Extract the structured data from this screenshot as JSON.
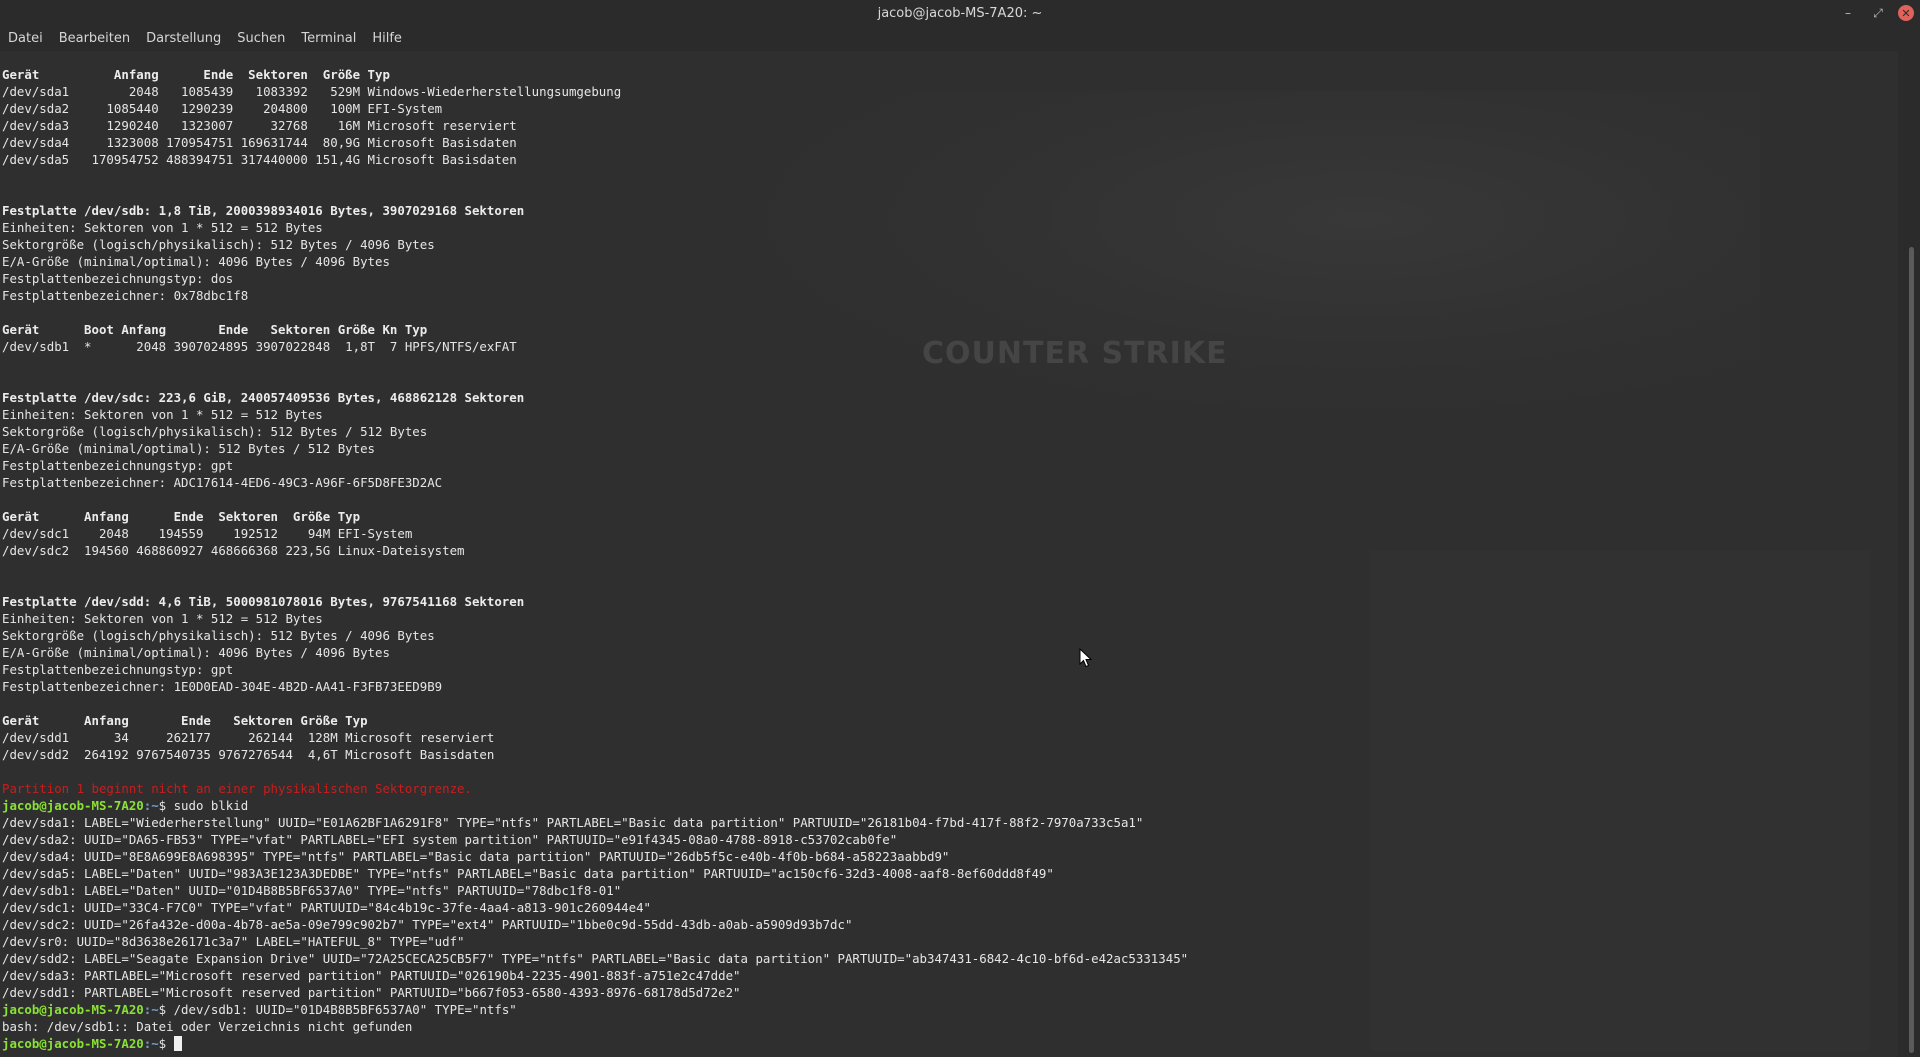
{
  "window": {
    "title": "jacob@jacob-MS-7A20: ~",
    "controls": {
      "minimize": "–",
      "maximize": "⤢",
      "close": "✕"
    }
  },
  "menubar": {
    "items": [
      "Datei",
      "Bearbeiten",
      "Darstellung",
      "Suchen",
      "Terminal",
      "Hilfe"
    ]
  },
  "background_art": {
    "logo_text": "COUNTER STRIKE"
  },
  "terminal": {
    "prompt_user": "jacob@jacob-MS-7A20",
    "prompt_path": ":~",
    "prompt_symbol": "$ ",
    "lines": [
      {
        "style": "bold",
        "text": "Gerät          Anfang      Ende  Sektoren  Größe Typ"
      },
      {
        "style": "normal",
        "text": "/dev/sda1        2048   1085439   1083392   529M Windows-Wiederherstellungsumgebung"
      },
      {
        "style": "normal",
        "text": "/dev/sda2     1085440   1290239    204800   100M EFI-System"
      },
      {
        "style": "normal",
        "text": "/dev/sda3     1290240   1323007     32768    16M Microsoft reserviert"
      },
      {
        "style": "normal",
        "text": "/dev/sda4     1323008 170954751 169631744  80,9G Microsoft Basisdaten"
      },
      {
        "style": "normal",
        "text": "/dev/sda5   170954752 488394751 317440000 151,4G Microsoft Basisdaten"
      },
      {
        "style": "normal",
        "text": ""
      },
      {
        "style": "normal",
        "text": ""
      },
      {
        "style": "bold",
        "text": "Festplatte /dev/sdb: 1,8 TiB, 2000398934016 Bytes, 3907029168 Sektoren"
      },
      {
        "style": "normal",
        "text": "Einheiten: Sektoren von 1 * 512 = 512 Bytes"
      },
      {
        "style": "normal",
        "text": "Sektorgröße (logisch/physikalisch): 512 Bytes / 4096 Bytes"
      },
      {
        "style": "normal",
        "text": "E/A-Größe (minimal/optimal): 4096 Bytes / 4096 Bytes"
      },
      {
        "style": "normal",
        "text": "Festplattenbezeichnungstyp: dos"
      },
      {
        "style": "normal",
        "text": "Festplattenbezeichner: 0x78dbc1f8"
      },
      {
        "style": "normal",
        "text": ""
      },
      {
        "style": "bold",
        "text": "Gerät      Boot Anfang       Ende   Sektoren Größe Kn Typ"
      },
      {
        "style": "normal",
        "text": "/dev/sdb1  *      2048 3907024895 3907022848  1,8T  7 HPFS/NTFS/exFAT"
      },
      {
        "style": "normal",
        "text": ""
      },
      {
        "style": "normal",
        "text": ""
      },
      {
        "style": "bold",
        "text": "Festplatte /dev/sdc: 223,6 GiB, 240057409536 Bytes, 468862128 Sektoren"
      },
      {
        "style": "normal",
        "text": "Einheiten: Sektoren von 1 * 512 = 512 Bytes"
      },
      {
        "style": "normal",
        "text": "Sektorgröße (logisch/physikalisch): 512 Bytes / 512 Bytes"
      },
      {
        "style": "normal",
        "text": "E/A-Größe (minimal/optimal): 512 Bytes / 512 Bytes"
      },
      {
        "style": "normal",
        "text": "Festplattenbezeichnungstyp: gpt"
      },
      {
        "style": "normal",
        "text": "Festplattenbezeichner: ADC17614-4ED6-49C3-A96F-6F5D8FE3D2AC"
      },
      {
        "style": "normal",
        "text": ""
      },
      {
        "style": "bold",
        "text": "Gerät      Anfang      Ende  Sektoren  Größe Typ"
      },
      {
        "style": "normal",
        "text": "/dev/sdc1    2048    194559    192512    94M EFI-System"
      },
      {
        "style": "normal",
        "text": "/dev/sdc2  194560 468860927 468666368 223,5G Linux-Dateisystem"
      },
      {
        "style": "normal",
        "text": ""
      },
      {
        "style": "normal",
        "text": ""
      },
      {
        "style": "bold",
        "text": "Festplatte /dev/sdd: 4,6 TiB, 5000981078016 Bytes, 9767541168 Sektoren"
      },
      {
        "style": "normal",
        "text": "Einheiten: Sektoren von 1 * 512 = 512 Bytes"
      },
      {
        "style": "normal",
        "text": "Sektorgröße (logisch/physikalisch): 512 Bytes / 4096 Bytes"
      },
      {
        "style": "normal",
        "text": "E/A-Größe (minimal/optimal): 4096 Bytes / 4096 Bytes"
      },
      {
        "style": "normal",
        "text": "Festplattenbezeichnungstyp: gpt"
      },
      {
        "style": "normal",
        "text": "Festplattenbezeichner: 1E0D0EAD-304E-4B2D-AA41-F3FB73EED9B9"
      },
      {
        "style": "normal",
        "text": ""
      },
      {
        "style": "bold",
        "text": "Gerät      Anfang       Ende   Sektoren Größe Typ"
      },
      {
        "style": "normal",
        "text": "/dev/sdd1      34     262177     262144  128M Microsoft reserviert"
      },
      {
        "style": "normal",
        "text": "/dev/sdd2  264192 9767540735 9767276544  4,6T Microsoft Basisdaten"
      },
      {
        "style": "normal",
        "text": ""
      },
      {
        "style": "error",
        "text": "Partition 1 beginnt nicht an einer physikalischen Sektorgrenze."
      },
      {
        "style": "prompt",
        "text": "sudo blkid"
      },
      {
        "style": "normal",
        "text": "/dev/sda1: LABEL=\"Wiederherstellung\" UUID=\"E01A62BF1A6291F8\" TYPE=\"ntfs\" PARTLABEL=\"Basic data partition\" PARTUUID=\"26181b04-f7bd-417f-88f2-7970a733c5a1\""
      },
      {
        "style": "normal",
        "text": "/dev/sda2: UUID=\"DA65-FB53\" TYPE=\"vfat\" PARTLABEL=\"EFI system partition\" PARTUUID=\"e91f4345-08a0-4788-8918-c53702cab0fe\""
      },
      {
        "style": "normal",
        "text": "/dev/sda4: UUID=\"8E8A699E8A698395\" TYPE=\"ntfs\" PARTLABEL=\"Basic data partition\" PARTUUID=\"26db5f5c-e40b-4f0b-b684-a58223aabbd9\""
      },
      {
        "style": "normal",
        "text": "/dev/sda5: LABEL=\"Daten\" UUID=\"983A3E123A3DEDBE\" TYPE=\"ntfs\" PARTLABEL=\"Basic data partition\" PARTUUID=\"ac150cf6-32d3-4008-aaf8-8ef60ddd8f49\""
      },
      {
        "style": "normal",
        "text": "/dev/sdb1: LABEL=\"Daten\" UUID=\"01D4B8B5BF6537A0\" TYPE=\"ntfs\" PARTUUID=\"78dbc1f8-01\""
      },
      {
        "style": "normal",
        "text": "/dev/sdc1: UUID=\"33C4-F7C0\" TYPE=\"vfat\" PARTUUID=\"84c4b19c-37fe-4aa4-a813-901c260944e4\""
      },
      {
        "style": "normal",
        "text": "/dev/sdc2: UUID=\"26fa432e-d00a-4b78-ae5a-09e799c902b7\" TYPE=\"ext4\" PARTUUID=\"1bbe0c9d-55dd-43db-a0ab-a5909d93b7dc\""
      },
      {
        "style": "normal",
        "text": "/dev/sr0: UUID=\"8d3638e26171c3a7\" LABEL=\"HATEFUL_8\" TYPE=\"udf\""
      },
      {
        "style": "normal",
        "text": "/dev/sdd2: LABEL=\"Seagate Expansion Drive\" UUID=\"72A25CECA25CB5F7\" TYPE=\"ntfs\" PARTLABEL=\"Basic data partition\" PARTUUID=\"ab347431-6842-4c10-bf6d-e42ac5331345\""
      },
      {
        "style": "normal",
        "text": "/dev/sda3: PARTLABEL=\"Microsoft reserved partition\" PARTUUID=\"026190b4-2235-4901-883f-a751e2c47dde\""
      },
      {
        "style": "normal",
        "text": "/dev/sdd1: PARTLABEL=\"Microsoft reserved partition\" PARTUUID=\"b667f053-6580-4393-8976-68178d5d72e2\""
      },
      {
        "style": "prompt",
        "text": "/dev/sdb1: UUID=\"01D4B8B5BF6537A0\" TYPE=\"ntfs\""
      },
      {
        "style": "normal",
        "text": "bash: /dev/sdb1:: Datei oder Verzeichnis nicht gefunden"
      },
      {
        "style": "prompt-cursor",
        "text": ""
      }
    ]
  }
}
